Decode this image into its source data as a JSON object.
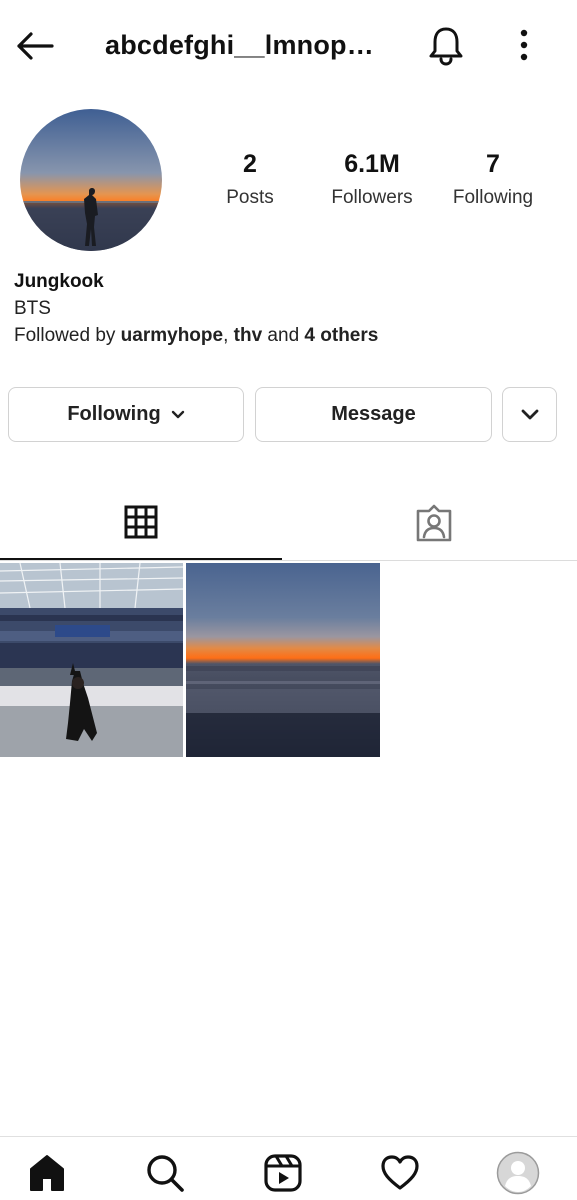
{
  "header": {
    "username": "abcdefghi__lmnopqr...",
    "back_icon": "arrow-left-icon",
    "notifications_icon": "bell-icon",
    "more_icon": "more-vertical-icon"
  },
  "profile": {
    "avatar": "sunset-silhouette-avatar",
    "stats": {
      "posts_count": "2",
      "posts_label": "Posts",
      "followers_count": "6.1M",
      "followers_label": "Followers",
      "following_count": "7",
      "following_label": "Following"
    },
    "bio": {
      "name": "Jungkook",
      "category": "BTS",
      "followed_by_prefix": "Followed by ",
      "followed_user_1": "uarmyhope",
      "separator": ", ",
      "followed_user_2": "thv",
      "and_text": " and ",
      "others": "4 others"
    }
  },
  "actions": {
    "following_label": "Following",
    "message_label": "Message"
  },
  "tabs": [
    {
      "name": "posts-grid",
      "icon": "grid-icon",
      "active": true
    },
    {
      "name": "tagged",
      "icon": "tagged-person-icon",
      "active": false
    }
  ],
  "posts": [
    {
      "name": "stadium-photo"
    },
    {
      "name": "beach-sunset-photo"
    }
  ],
  "bottom_nav": [
    {
      "icon": "home-icon",
      "active": true
    },
    {
      "icon": "search-icon"
    },
    {
      "icon": "reels-icon"
    },
    {
      "icon": "heart-icon"
    },
    {
      "icon": "profile-avatar-icon"
    }
  ],
  "colors": {
    "text": "#111111",
    "secondary_text": "#333333",
    "border": "#d2d2d2",
    "sky_top": "#4a6a9a",
    "sunset_orange": "#ff7a1e"
  }
}
